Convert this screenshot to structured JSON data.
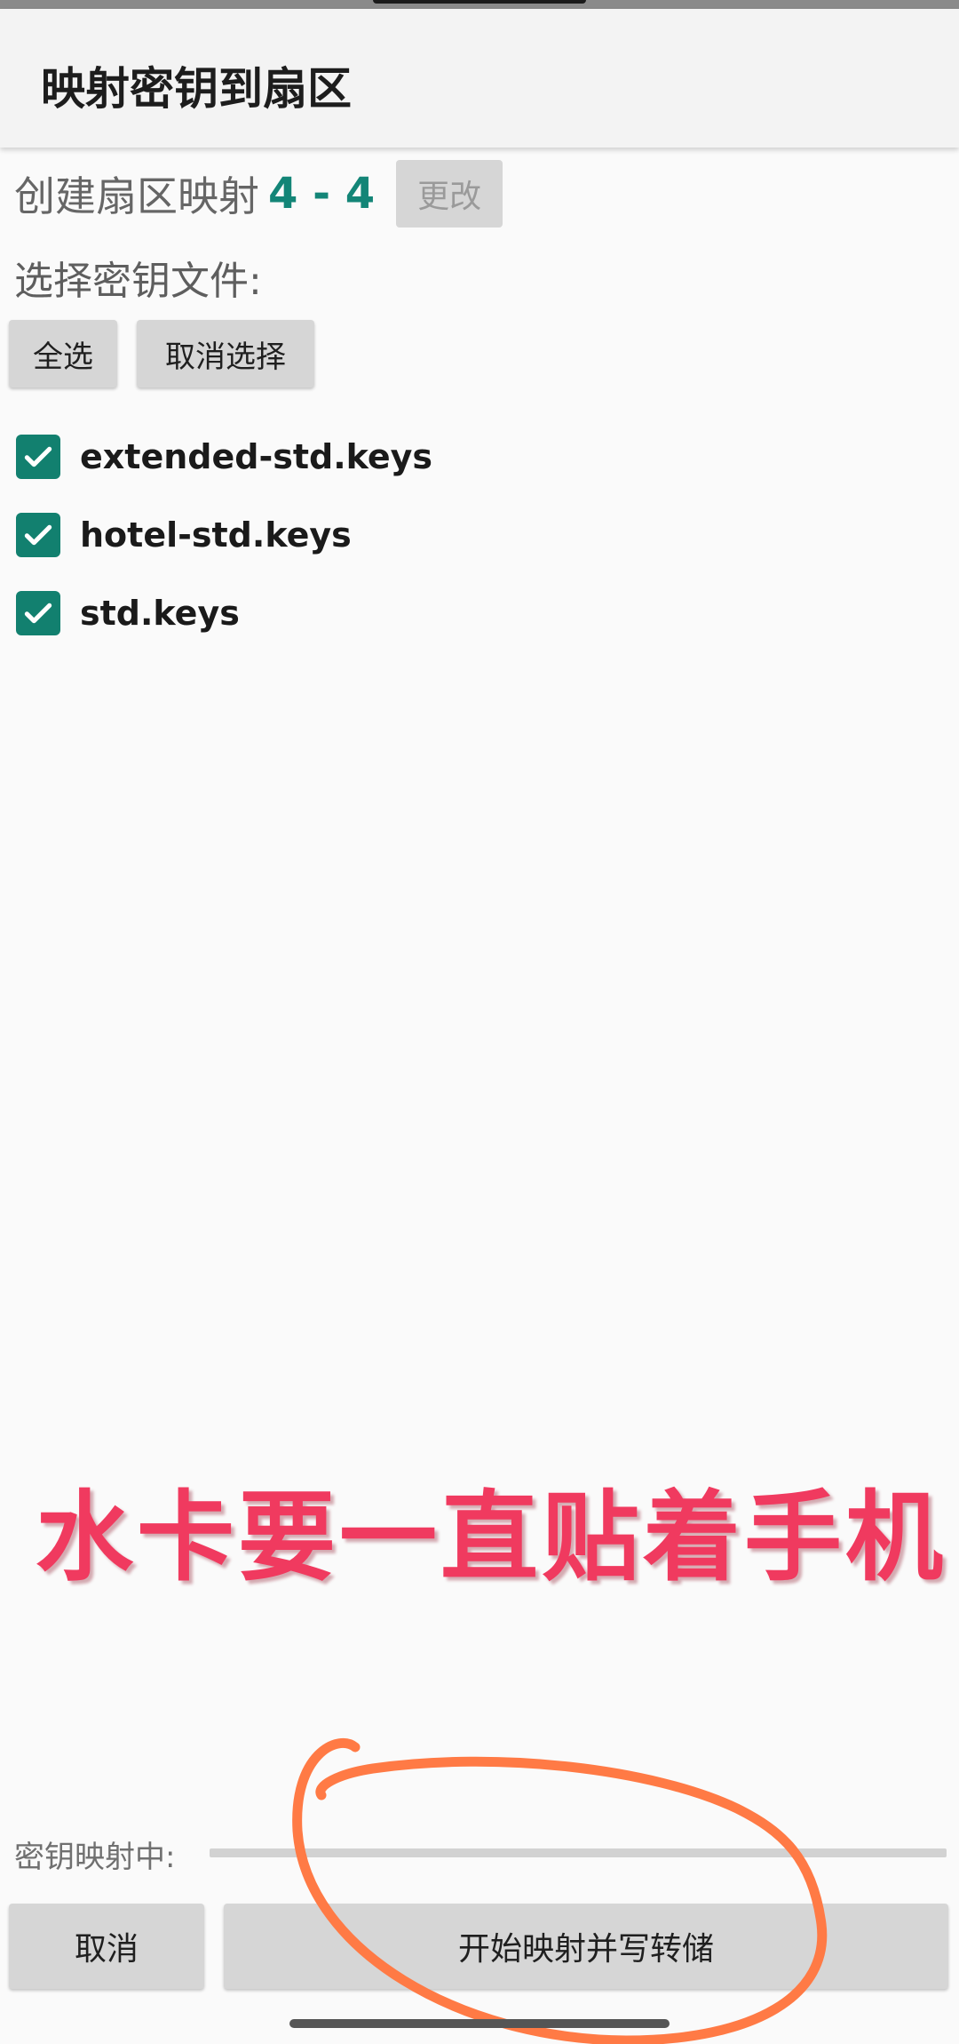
{
  "app_bar": {
    "title": "映射密钥到扇区"
  },
  "sector": {
    "label": "创建扇区映射",
    "range": "4 - 4",
    "change_label": "更改"
  },
  "key_select": {
    "label": "选择密钥文件:",
    "select_all_label": "全选",
    "deselect_label": "取消选择",
    "files": [
      {
        "name": "extended-std.keys",
        "checked": true
      },
      {
        "name": "hotel-std.keys",
        "checked": true
      },
      {
        "name": "std.keys",
        "checked": true
      }
    ]
  },
  "overlay": {
    "note": "水卡要一直贴着手机"
  },
  "progress": {
    "label": "密钥映射中:",
    "value": 0
  },
  "actions": {
    "cancel_label": "取消",
    "start_label": "开始映射并写转储"
  },
  "colors": {
    "accent": "#138577",
    "checkbox": "#12806f",
    "overlay_text": "#f03a5f",
    "scribble": "#ff7a45"
  },
  "icons": {
    "checkbox": "checkmark-icon"
  }
}
